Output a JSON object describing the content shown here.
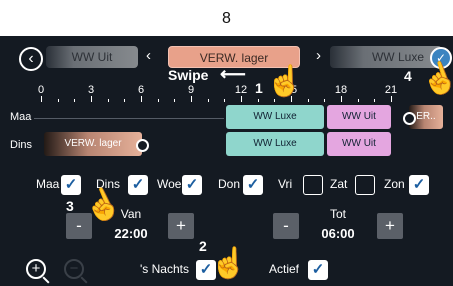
{
  "step_number": "8",
  "carousel": {
    "back_icon": "back-circle-icon",
    "prev_item": "WW Uit",
    "current_item": "VERW. lager",
    "next_item": "WW Luxe",
    "prev_arrow": "‹",
    "next_arrow": "›",
    "swipe_label": "Swipe",
    "swipe_arrow": "⟵",
    "confirm_icon": "check-icon"
  },
  "timeline": {
    "ticks": [
      "0",
      "3",
      "6",
      "9",
      "12",
      "15",
      "18",
      "21"
    ],
    "rows": [
      {
        "label": "Maa",
        "blocks": [
          "WW Luxe",
          "WW Uit",
          "ER.."
        ]
      },
      {
        "label": "Dins",
        "blocks": [
          "VERW. lager",
          "WW Luxe",
          "WW Uit"
        ]
      }
    ]
  },
  "days": [
    {
      "label": "Maa",
      "checked": true
    },
    {
      "label": "Dins",
      "checked": true
    },
    {
      "label": "Woe",
      "checked": true
    },
    {
      "label": "Don",
      "checked": true
    },
    {
      "label": "Vri",
      "checked": false
    },
    {
      "label": "Zat",
      "checked": false
    },
    {
      "label": "Zon",
      "checked": true
    }
  ],
  "from": {
    "label": "Van",
    "value": "22:00",
    "minus": "-",
    "plus": "+"
  },
  "to": {
    "label": "Tot",
    "value": "06:00",
    "minus": "-",
    "plus": "+"
  },
  "options": {
    "nights_label": "'s Nachts",
    "nights_checked": true,
    "active_label": "Actief",
    "active_checked": true
  },
  "zoom": {
    "in_icon": "+",
    "out_icon": "−"
  },
  "annotations": [
    "1",
    "2",
    "3",
    "4"
  ],
  "colors": {
    "teal": "#8fd6cc",
    "pink": "#e4a6e0",
    "selected": "#e8a18a",
    "accent": "#3b84c0"
  }
}
